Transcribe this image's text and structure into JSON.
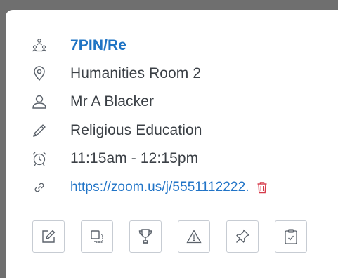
{
  "lesson": {
    "group_code": "7PIN/Re",
    "room": "Humanities Room 2",
    "teacher": "Mr A Blacker",
    "subject": "Religious Education",
    "time": "11:15am - 12:15pm",
    "meeting_link": "https://zoom.us/j/5551112222."
  },
  "icons": {
    "group": "group-icon",
    "location": "location-pin-icon",
    "teacher": "person-icon",
    "subject": "pencil-icon",
    "time": "alarm-clock-icon",
    "link": "link-icon",
    "delete": "trash-icon"
  },
  "actions": [
    {
      "id": "edit",
      "icon": "edit-icon"
    },
    {
      "id": "copy",
      "icon": "copy-icon"
    },
    {
      "id": "award",
      "icon": "trophy-icon"
    },
    {
      "id": "warning",
      "icon": "warning-icon"
    },
    {
      "id": "pin",
      "icon": "pin-icon"
    },
    {
      "id": "register",
      "icon": "clipboard-check-icon"
    }
  ],
  "colors": {
    "accent": "#1f74c4",
    "text": "#3b4046",
    "icon": "#5b626b",
    "danger": "#d63a4a",
    "button_border": "#c7ccd3"
  }
}
